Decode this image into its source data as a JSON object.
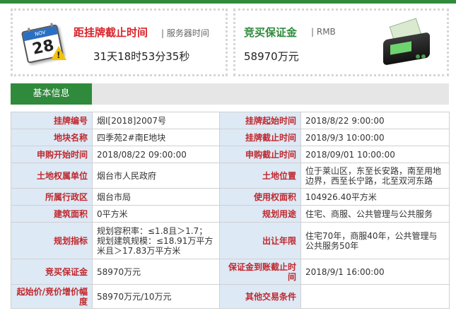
{
  "countdown": {
    "title": "距挂牌截止时间",
    "subtitle": "服务器时间",
    "value": "31天18时53分35秒",
    "icon": "calendar-warning-icon",
    "calendar_month": "NOV",
    "calendar_day": "28"
  },
  "deposit_card": {
    "title": "竞买保证金",
    "subtitle": "RMB",
    "value": "58970万元",
    "icon": "money-machine-icon"
  },
  "section": {
    "tab_label": "基本信息"
  },
  "colors": {
    "accent_green": "#2f8a3c",
    "alert_red": "#d8232a",
    "label_bg": "#dde9f5",
    "label_text": "#c0282d"
  },
  "rows": [
    {
      "l1": "挂牌编号",
      "v1": "烟Ⅰ[2018]2007号",
      "l2": "挂牌起始时间",
      "v2": "2018/8/22 9:00:00"
    },
    {
      "l1": "地块名称",
      "v1": "四季苑2#南E地块",
      "l2": "挂牌截止时间",
      "v2": "2018/9/3 10:00:00"
    },
    {
      "l1": "申购开始时间",
      "v1": "2018/08/22 09:00:00",
      "l2": "申购截止时间",
      "v2": "2018/09/01 10:00:00"
    },
    {
      "l1": "土地权属单位",
      "v1": "烟台市人民政府",
      "l2": "土地位置",
      "v2": "位于莱山区，东至长安路，南至用地边界，西至长宁路，北至双河东路"
    },
    {
      "l1": "所属行政区",
      "v1": "烟台市局",
      "l2": "使用权面积",
      "v2": "104926.40平方米"
    },
    {
      "l1": "建筑面积",
      "v1": "0平方米",
      "l2": "规划用途",
      "v2": "住宅、商服、公共管理与公共服务"
    },
    {
      "l1": "规划指标",
      "v1": "规划容积率：≤1.8且＞1.7；规划建筑规模：≤18.91万平方米且＞17.83万平方米",
      "l2": "出让年限",
      "v2": "住宅70年，商服40年，公共管理与公共服务50年"
    },
    {
      "l1": "竞买保证金",
      "v1": "58970万元",
      "l2": "保证金到账截止时间",
      "v2": "2018/9/1 16:00:00"
    },
    {
      "l1": "起始价/竞价增价幅度",
      "v1": "58970万元/10万元",
      "l2": "其他交易条件",
      "v2": ""
    }
  ]
}
